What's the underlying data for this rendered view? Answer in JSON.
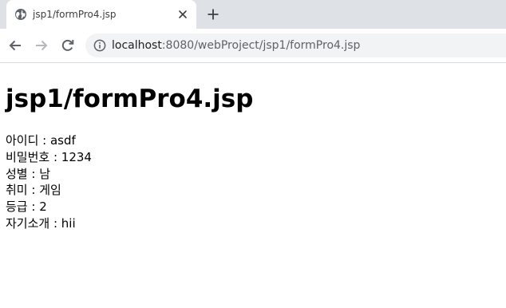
{
  "browser": {
    "tab": {
      "title": "jsp1/formPro4.jsp",
      "favicon": "globe-icon",
      "close_icon": "close-icon"
    },
    "new_tab_icon": "plus-icon",
    "nav": {
      "back_icon": "arrow-left-icon",
      "forward_icon": "arrow-right-icon",
      "reload_icon": "reload-icon"
    },
    "address_bar": {
      "info_icon": "info-icon",
      "host": "localhost",
      "rest": ":8080/webProject/jsp1/formPro4.jsp"
    }
  },
  "page": {
    "heading": "jsp1/formPro4.jsp",
    "lines": [
      "아이디 : asdf",
      "비밀번호 : 1234",
      "성별 : 남",
      "취미 : 게임",
      "등급 : 2",
      "자기소개 : hii"
    ]
  },
  "colors": {
    "tabstrip": "#dee1e6",
    "omnibox": "#f1f3f4",
    "icon": "#5f6368",
    "icon_disabled": "#b4b7bb"
  }
}
